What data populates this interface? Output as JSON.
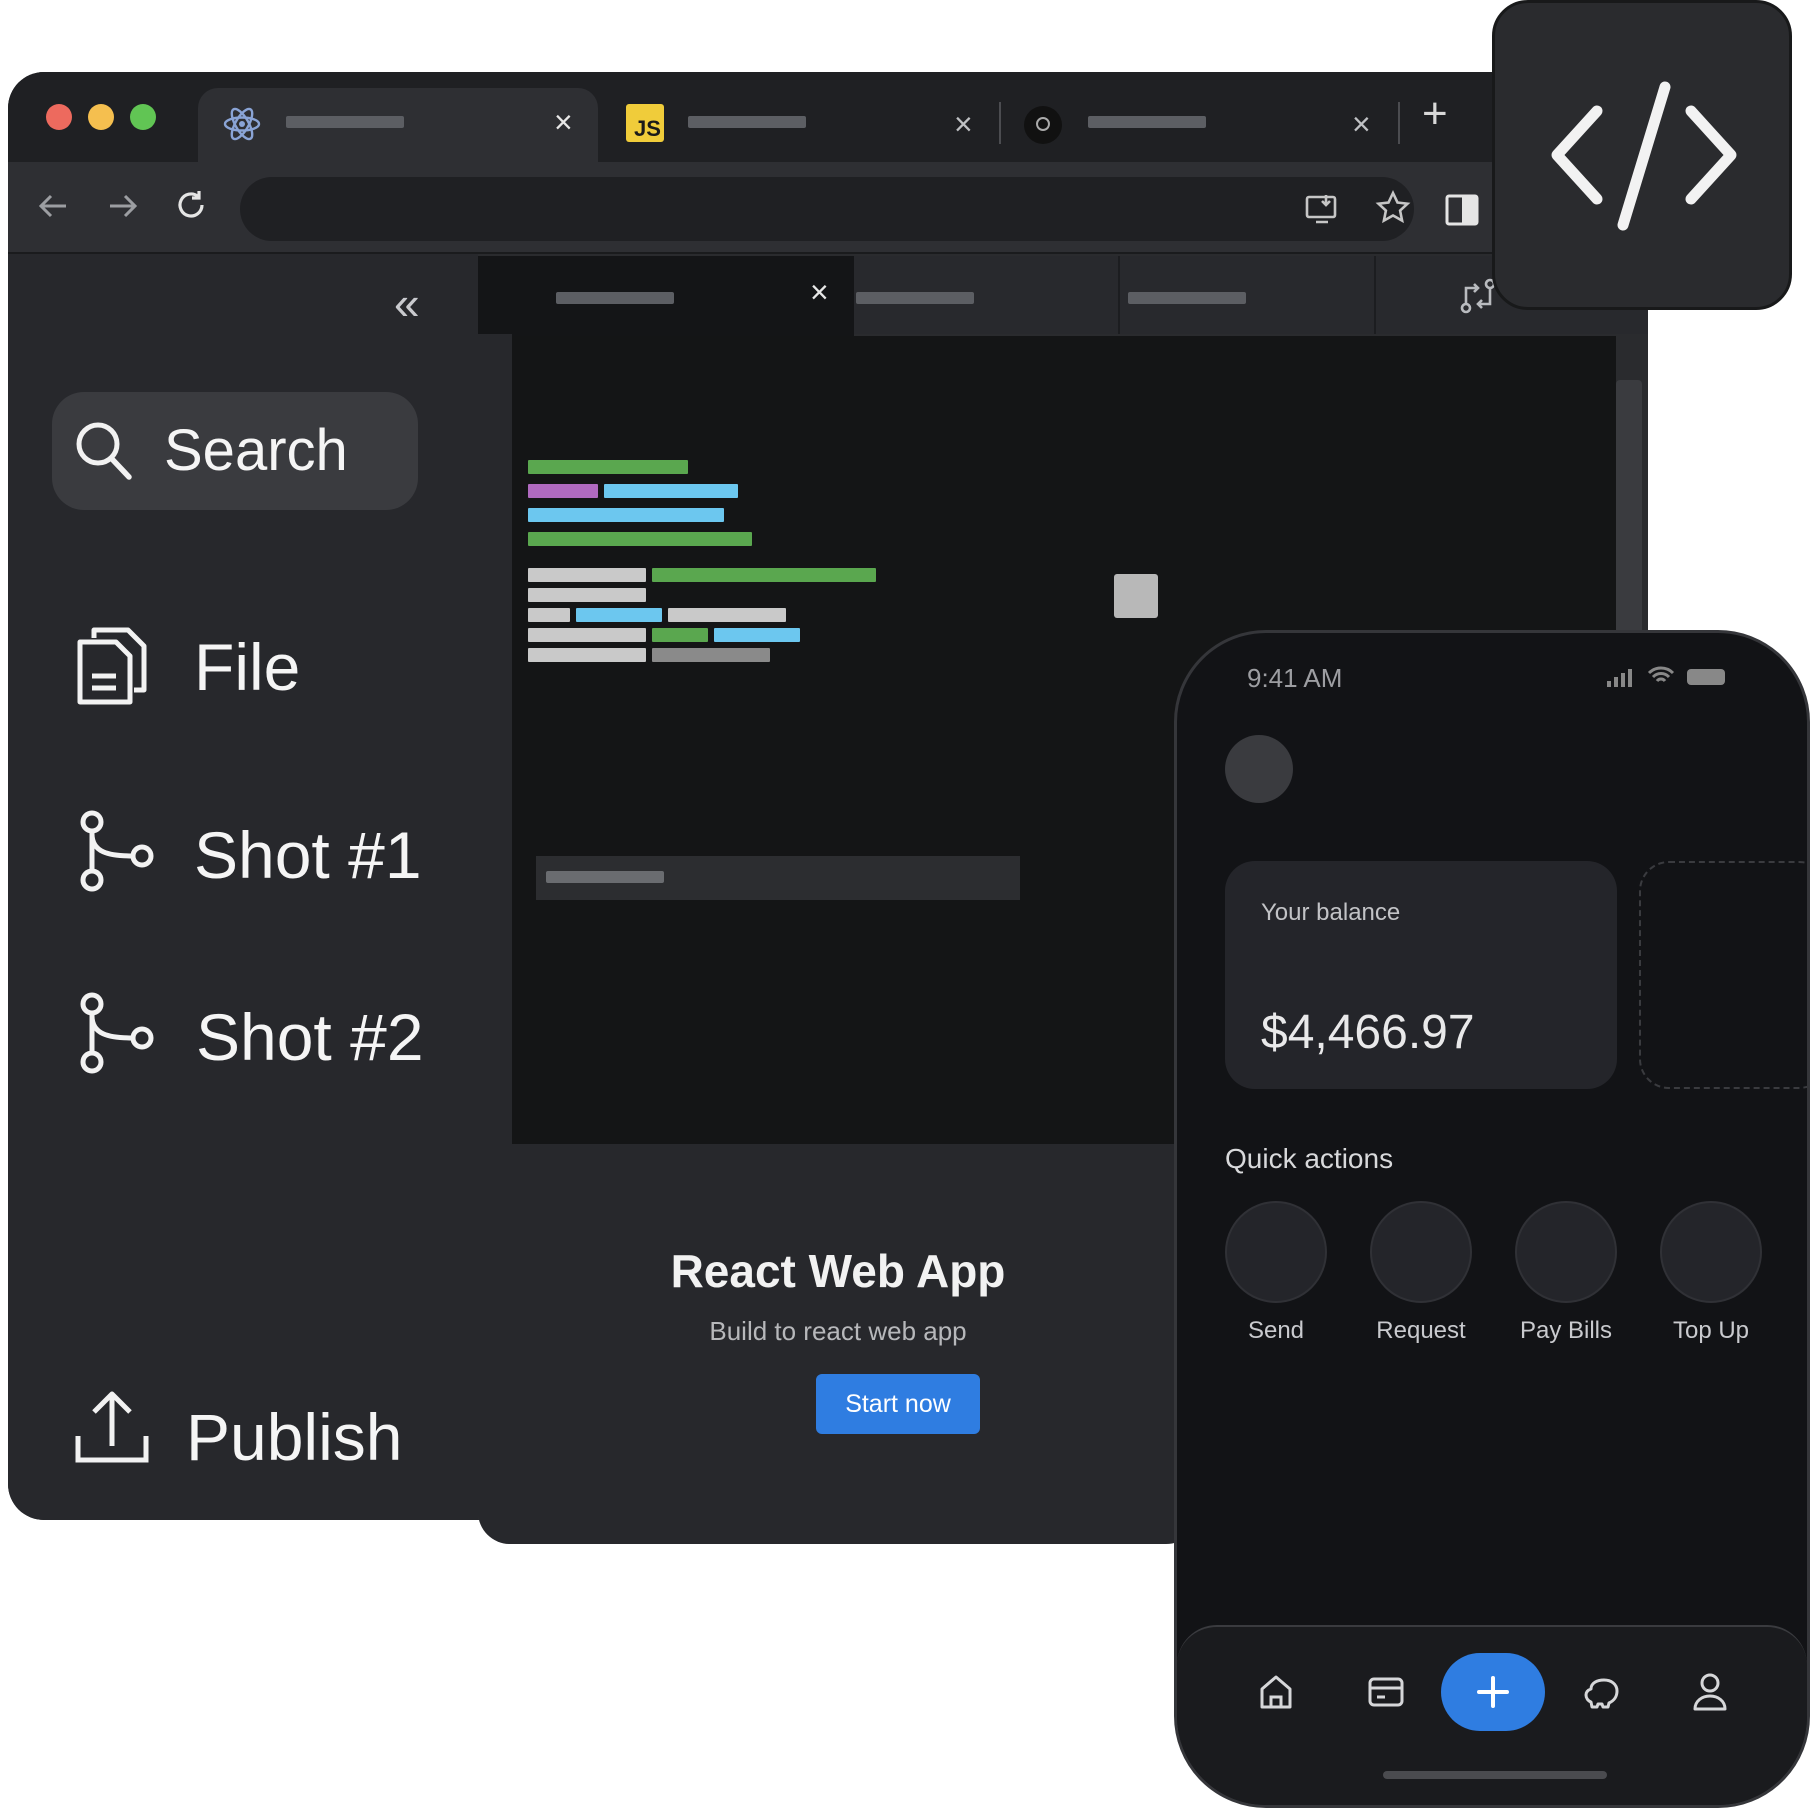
{
  "browser": {
    "traffic_lights": [
      "#ed6a5e",
      "#f5bf4f",
      "#61c554"
    ],
    "tabs": [
      {
        "icon": "react-icon",
        "active": true
      },
      {
        "icon": "js-icon",
        "icon_text": "JS",
        "active": false
      },
      {
        "icon": "github-icon",
        "active": false
      }
    ],
    "new_tab_label": "+",
    "close_label": "×"
  },
  "sidebar": {
    "collapse_label": "«",
    "search_label": "Search",
    "items": [
      {
        "label": "File",
        "icon": "file-icon"
      },
      {
        "label": "Shot #1",
        "icon": "branch-icon"
      },
      {
        "label": "Shot #2",
        "icon": "branch-icon"
      }
    ],
    "publish_label": "Publish"
  },
  "preview": {
    "title": "React Web App",
    "subtitle": "Build to react web app",
    "button_label": "Start now",
    "button_color": "#2f7de1"
  },
  "badge": {
    "icon": "code-icon"
  },
  "phone": {
    "time": "9:41 AM",
    "balance_label": "Your balance",
    "balance_value": "$4,466.97",
    "quick_actions_label": "Quick actions",
    "actions": [
      "Send",
      "Request",
      "Pay Bills",
      "Top Up"
    ],
    "tabbar": [
      "home-icon",
      "card-icon",
      "add-icon",
      "savings-icon",
      "profile-icon"
    ],
    "accent": "#2f7de1"
  }
}
